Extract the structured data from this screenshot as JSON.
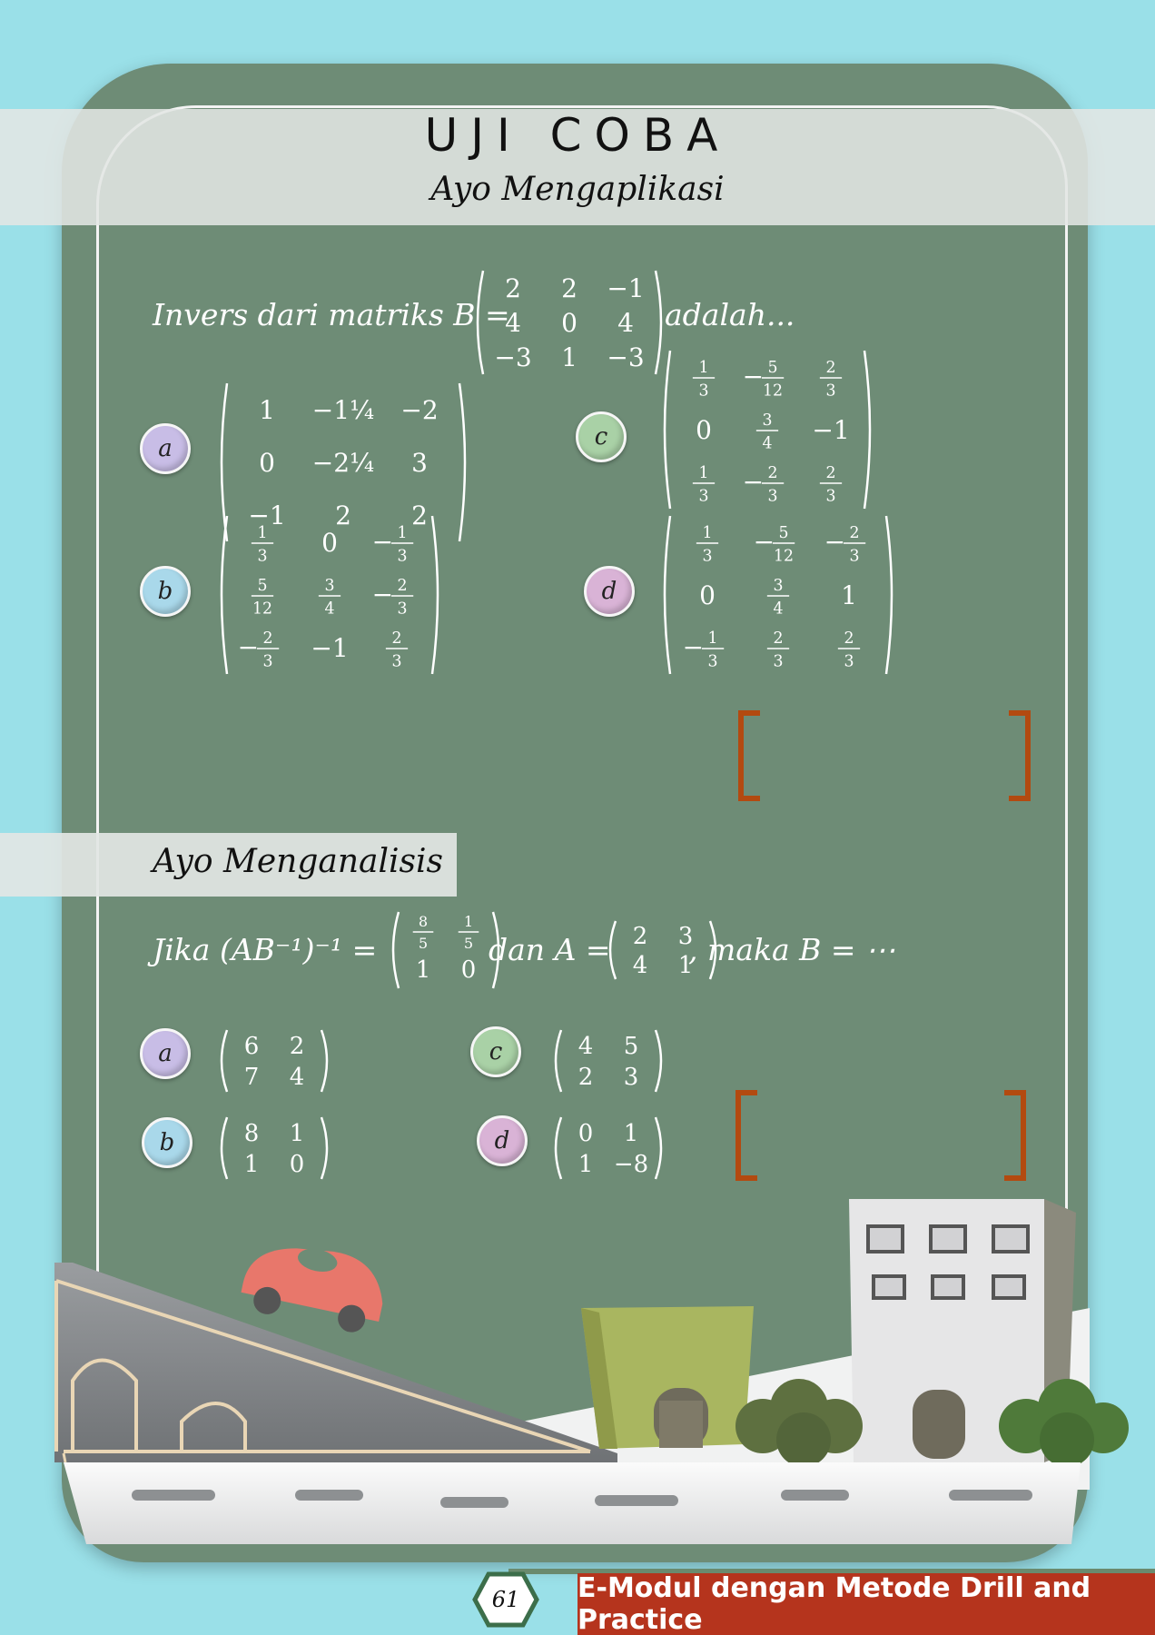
{
  "header": {
    "title": "UJI COBA",
    "subtitle": "Ayo Mengaplikasi"
  },
  "question1": {
    "prefix": "Invers dari matriks",
    "var": "B",
    "eq": "=",
    "suffix": "adalah...",
    "matrix": [
      [
        "2",
        "2",
        "−1"
      ],
      [
        "4",
        "0",
        "4"
      ],
      [
        "−3",
        "1",
        "−3"
      ]
    ],
    "options": [
      {
        "letter": "a",
        "color": "#c8bde6",
        "matrix": [
          [
            "1",
            "−1¼",
            "−2"
          ],
          [
            "0",
            "−2¼",
            "3"
          ],
          [
            "−1",
            "2",
            "2"
          ]
        ]
      },
      {
        "letter": "b",
        "color": "#a9d8ea",
        "matrix": [
          [
            "1/3",
            "0",
            "−1/3"
          ],
          [
            "5/12",
            "3/4",
            "−2/3"
          ],
          [
            "−2/3",
            "−1",
            "2/3"
          ]
        ]
      },
      {
        "letter": "c",
        "color": "#a9d1a6",
        "matrix": [
          [
            "1/3",
            "−5/12",
            "2/3"
          ],
          [
            "0",
            "3/4",
            "−1"
          ],
          [
            "1/3",
            "−2/3",
            "2/3"
          ]
        ]
      },
      {
        "letter": "d",
        "color": "#d9b3d6",
        "matrix": [
          [
            "1/3",
            "−5/12",
            "−2/3"
          ],
          [
            "0",
            "3/4",
            "1"
          ],
          [
            "−1/3",
            "2/3",
            "2/3"
          ]
        ]
      }
    ]
  },
  "section2": {
    "title": "Ayo Menganalisis"
  },
  "question2": {
    "prefix": "Jika",
    "expr": "(AB⁻¹)⁻¹ =",
    "lhs_matrix": [
      [
        "8/5",
        "1/5"
      ],
      [
        "1",
        "0"
      ]
    ],
    "mid": "dan",
    "a_expr": "A =",
    "a_matrix": [
      [
        "2",
        "3"
      ],
      [
        "4",
        "1"
      ]
    ],
    "suffix": ", maka",
    "b_expr": "B = ⋯",
    "options": [
      {
        "letter": "a",
        "color": "#c8bde6",
        "matrix": [
          [
            "6",
            "2"
          ],
          [
            "7",
            "4"
          ]
        ]
      },
      {
        "letter": "b",
        "color": "#a9d8ea",
        "matrix": [
          [
            "8",
            "1"
          ],
          [
            "1",
            "0"
          ]
        ]
      },
      {
        "letter": "c",
        "color": "#a9d1a6",
        "matrix": [
          [
            "4",
            "5"
          ],
          [
            "2",
            "3"
          ]
        ]
      },
      {
        "letter": "d",
        "color": "#d9b3d6",
        "matrix": [
          [
            "0",
            "1"
          ],
          [
            "1",
            "−8"
          ]
        ]
      }
    ]
  },
  "answer_bracket_color": "#b34a10",
  "footer": {
    "page_number": "61",
    "text": "E-Modul dengan Metode Drill and Practice"
  },
  "illustration": {
    "items": [
      "bridge",
      "car",
      "green-house",
      "apartment-building",
      "bush",
      "road"
    ]
  }
}
